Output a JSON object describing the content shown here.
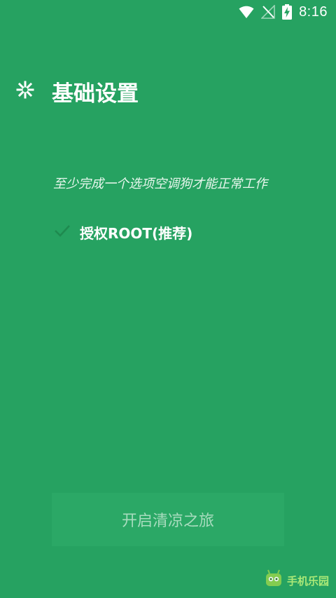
{
  "status_bar": {
    "time": "8:16",
    "icons": [
      "wifi-icon",
      "no-signal-icon",
      "battery-charging-icon"
    ]
  },
  "header": {
    "icon": "snowflake-icon",
    "title": "基础设置"
  },
  "hint": "至少完成一个选项空调狗才能正常工作",
  "options": [
    {
      "icon": "check-icon",
      "label": "授权ROOT(推荐)"
    }
  ],
  "start_button": {
    "label": "开启清凉之旅"
  },
  "watermark": {
    "text": "手机乐园"
  },
  "colors": {
    "background": "#26a261",
    "button": "#2ba866",
    "button_text": "#a8dcbe",
    "check": "#1e8a4f"
  }
}
